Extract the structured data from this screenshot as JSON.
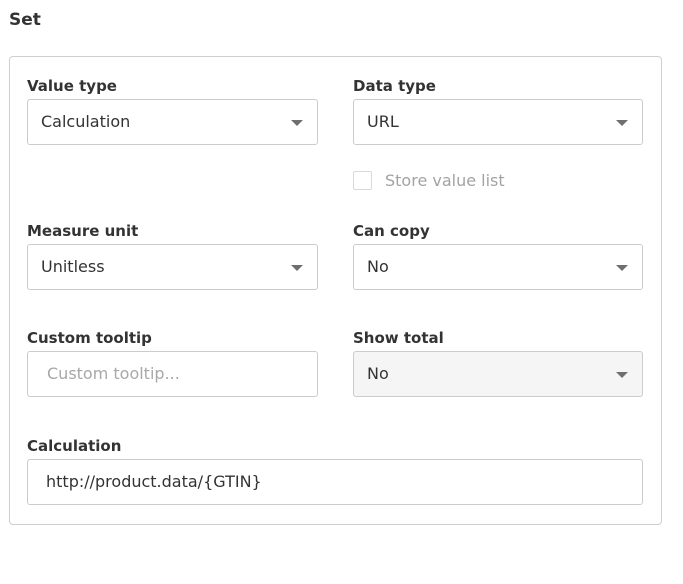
{
  "section": {
    "title": "Set"
  },
  "form": {
    "value_type": {
      "label": "Value type",
      "value": "Calculation"
    },
    "data_type": {
      "label": "Data type",
      "value": "URL"
    },
    "store_value_list": {
      "label": "Store value list",
      "checked": false
    },
    "measure_unit": {
      "label": "Measure unit",
      "value": "Unitless"
    },
    "can_copy": {
      "label": "Can copy",
      "value": "No"
    },
    "custom_tooltip": {
      "label": "Custom tooltip",
      "value": "",
      "placeholder": "Custom tooltip..."
    },
    "show_total": {
      "label": "Show total",
      "value": "No"
    },
    "calculation": {
      "label": "Calculation",
      "value": "http://product.data/{GTIN}"
    }
  },
  "icons": {
    "dropdown": "chevron-down-icon"
  }
}
